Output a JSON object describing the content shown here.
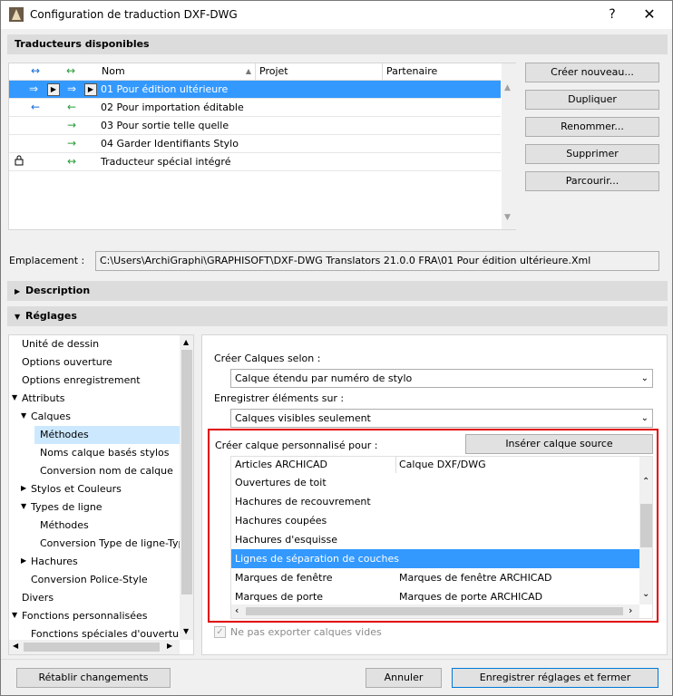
{
  "window": {
    "title": "Configuration de traduction DXF-DWG",
    "help_glyph": "?",
    "close_glyph": "✕"
  },
  "translators_section": {
    "title": "Traducteurs disponibles"
  },
  "translators_table": {
    "headers": [
      "Nom",
      "Projet",
      "Partenaire"
    ],
    "rows": [
      {
        "name": "01 Pour édition ultérieure",
        "arrow1": "⇒",
        "arrow2": "⇒",
        "selected": true
      },
      {
        "name": "02 Pour importation éditable",
        "arrow1": "←",
        "arrow2": "←",
        "selected": false
      },
      {
        "name": "03 Pour sortie telle quelle",
        "arrow1": "",
        "arrow2": "→",
        "selected": false
      },
      {
        "name": "04 Garder Identifiants Stylo",
        "arrow1": "",
        "arrow2": "→",
        "selected": false
      },
      {
        "name": "Traducteur spécial intégré",
        "arrow1": "",
        "arrow2": "↔",
        "selected": false
      }
    ],
    "header_arrow1": "↔",
    "header_arrow2": "↔",
    "lock_glyph": "🔒"
  },
  "side_buttons": {
    "create": "Créer nouveau...",
    "duplicate": "Dupliquer",
    "rename": "Renommer...",
    "delete": "Supprimer",
    "browse": "Parcourir..."
  },
  "location": {
    "label": "Emplacement :",
    "path": "C:\\Users\\ArchiGraphi\\GRAPHISOFT\\DXF-DWG Translators 21.0.0 FRA\\01 Pour édition ultérieure.Xml"
  },
  "description_section": {
    "title": "Description"
  },
  "settings_section": {
    "title": "Réglages"
  },
  "settings_tree": [
    "Unité de dessin",
    "Options ouverture",
    "Options enregistrement",
    "Attributs",
    "Calques",
    "Méthodes",
    "Noms calque basés stylos",
    "Conversion nom de calque",
    "Stylos et Couleurs",
    "Types de ligne",
    "Méthodes",
    "Conversion Type de ligne-Type",
    "Hachures",
    "Conversion Police-Style",
    "Divers",
    "Fonctions personnalisées",
    "Fonctions spéciales d'ouverture"
  ],
  "layers_form": {
    "create_layers_label": "Créer Calques selon :",
    "create_layers_value": "Calque étendu par numéro de stylo",
    "save_elements_label": "Enregistrer éléments sur :",
    "save_elements_value": "Calques visibles seulement",
    "custom_layer_label": "Créer calque personnalisé pour :",
    "insert_source_button": "Insérer calque source",
    "list_headers": [
      "Articles ARCHICAD",
      "Calque DXF/DWG"
    ],
    "list_rows": [
      {
        "item": "Ouvertures de toit",
        "layer": "",
        "selected": false
      },
      {
        "item": "Hachures de recouvrement",
        "layer": "",
        "selected": false
      },
      {
        "item": "Hachures coupées",
        "layer": "",
        "selected": false
      },
      {
        "item": "Hachures d'esquisse",
        "layer": "",
        "selected": false
      },
      {
        "item": "Lignes de séparation de couches",
        "layer": "",
        "selected": true
      },
      {
        "item": "Marques de fenêtre",
        "layer": "Marques de fenêtre ARCHICAD",
        "selected": false
      },
      {
        "item": "Marques de porte",
        "layer": "Marques de porte ARCHICAD",
        "selected": false
      }
    ],
    "empty_layers_checkbox": "Ne pas exporter calques vides",
    "empty_layers_checked": true
  },
  "footer": {
    "reset": "Rétablir changements",
    "cancel": "Annuler",
    "save_close": "Enregistrer réglages et fermer"
  },
  "colors": {
    "selection": "#3399ff",
    "highlight_border": "#e00000",
    "tree_selection": "#cce8ff"
  }
}
